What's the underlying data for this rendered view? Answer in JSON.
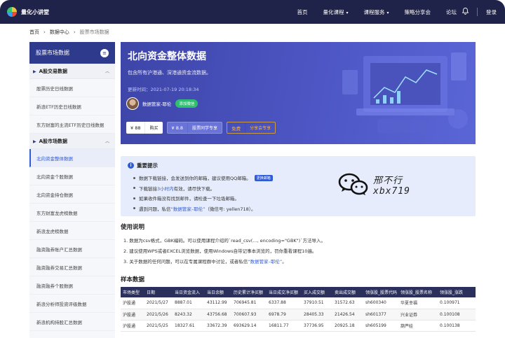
{
  "nav": {
    "brand": "量化小讲堂",
    "links": [
      {
        "label": "首页",
        "caret": ""
      },
      {
        "label": "量化课程",
        "caret": "▾"
      },
      {
        "label": "课程服务",
        "caret": "▾"
      },
      {
        "label": "策略分享会",
        "caret": ""
      },
      {
        "label": "论坛",
        "caret": ""
      }
    ],
    "login": "登录"
  },
  "breadcrumb": {
    "home": "首页",
    "sep": "›",
    "section": "数据中心",
    "current": "股票市场数据"
  },
  "sidebar": {
    "title": "股票市场数据",
    "groups": [
      {
        "label": "A股交易数据",
        "items": [
          "股票历史日线数据",
          "新浪ETF历史日线数据",
          "东方财富的主流ETF历史日线数据"
        ]
      },
      {
        "label": "A股市场数据",
        "items": [
          "北向资金整体数据",
          "北向资金个股数据",
          "北向资金持仓数据",
          "东方财富龙虎榜数据",
          "新浪龙虎榜数据",
          "融资融券账户汇总数据",
          "融资融券交易汇总数据",
          "融资融券个股数据",
          "新浪分析师投资评级数据",
          "新浪机构持股汇总数据"
        ]
      }
    ]
  },
  "hero": {
    "title": "北向资金整体数据",
    "subtitle": "包含所有沪港通、深港通资金流数据。",
    "updated": "更新时间：2021-07-19 20:18:34",
    "author": "数据管家-耶伦",
    "add_wechat": "添加微信",
    "buy": {
      "price": "¥ 88",
      "label": "购买"
    },
    "vip": {
      "price": "¥ 8.8",
      "label": "股票同学专享"
    },
    "free": {
      "price": "免费",
      "label": "分享会专享"
    }
  },
  "notice": {
    "title": "重要提示",
    "items": [
      {
        "pre": "数据下载链接，会发送到你的邮箱，建议使用QQ邮箱。",
        "tag": "更换邮箱"
      },
      {
        "pre": "下载链接 ",
        "highlight": "3小时内",
        "post": " 有效，请尽快下载。"
      },
      {
        "pre": "如果收件箱没有找到邮件，请检查一下垃圾邮箱。"
      },
      {
        "pre": "遇到问题，私信 ",
        "highlight": "“数据管家–耶伦”",
        "post": "（微信号: yellen718）。"
      }
    ],
    "contact_line1": "邢不行",
    "contact_line2": "xbx719"
  },
  "usage": {
    "title": "使用说明",
    "lines": [
      "1. 数据为csv格式，GBK编码。可以使用课程介绍的`read_csv(..., encoding=\"GBK\")`方法导入。",
      "2. 建议使用WPS或者EXCEL浏览数据，使用Windows自带记事本浏览的，罚你重看课程10遍。",
      "3. 关于数据的任何问题，可以在专属课程群中讨论，或者私信 "
    ],
    "line3_highlight": "“数据管家–耶伦”",
    "line3_end": "。"
  },
  "sample": {
    "title": "样本数据",
    "headers": [
      "市场类型",
      "日期",
      "当日资金流入",
      "当日余额",
      "历史累计净买额",
      "当日成交净买额",
      "买入成交额",
      "卖出成交额",
      "领涨股_股票代码",
      "领涨股_股票名称",
      "领涨股_涨跌"
    ],
    "rows": [
      [
        "沪股通",
        "2021/5/27",
        "8887.01",
        "43112.99",
        "706945.81",
        "6337.88",
        "37910.51",
        "31572.63",
        "sh600340",
        "华夏幸福",
        "0.100971"
      ],
      [
        "沪股通",
        "2021/5/26",
        "8243.32",
        "43756.68",
        "700607.93",
        "6978.79",
        "28405.33",
        "21426.54",
        "sh601377",
        "兴业证券",
        "0.100108"
      ],
      [
        "沪股通",
        "2021/5/25",
        "18327.61",
        "33672.39",
        "693629.14",
        "16811.77",
        "37736.95",
        "20925.18",
        "sh605199",
        "葫芦娃",
        "0.100138"
      ]
    ]
  }
}
